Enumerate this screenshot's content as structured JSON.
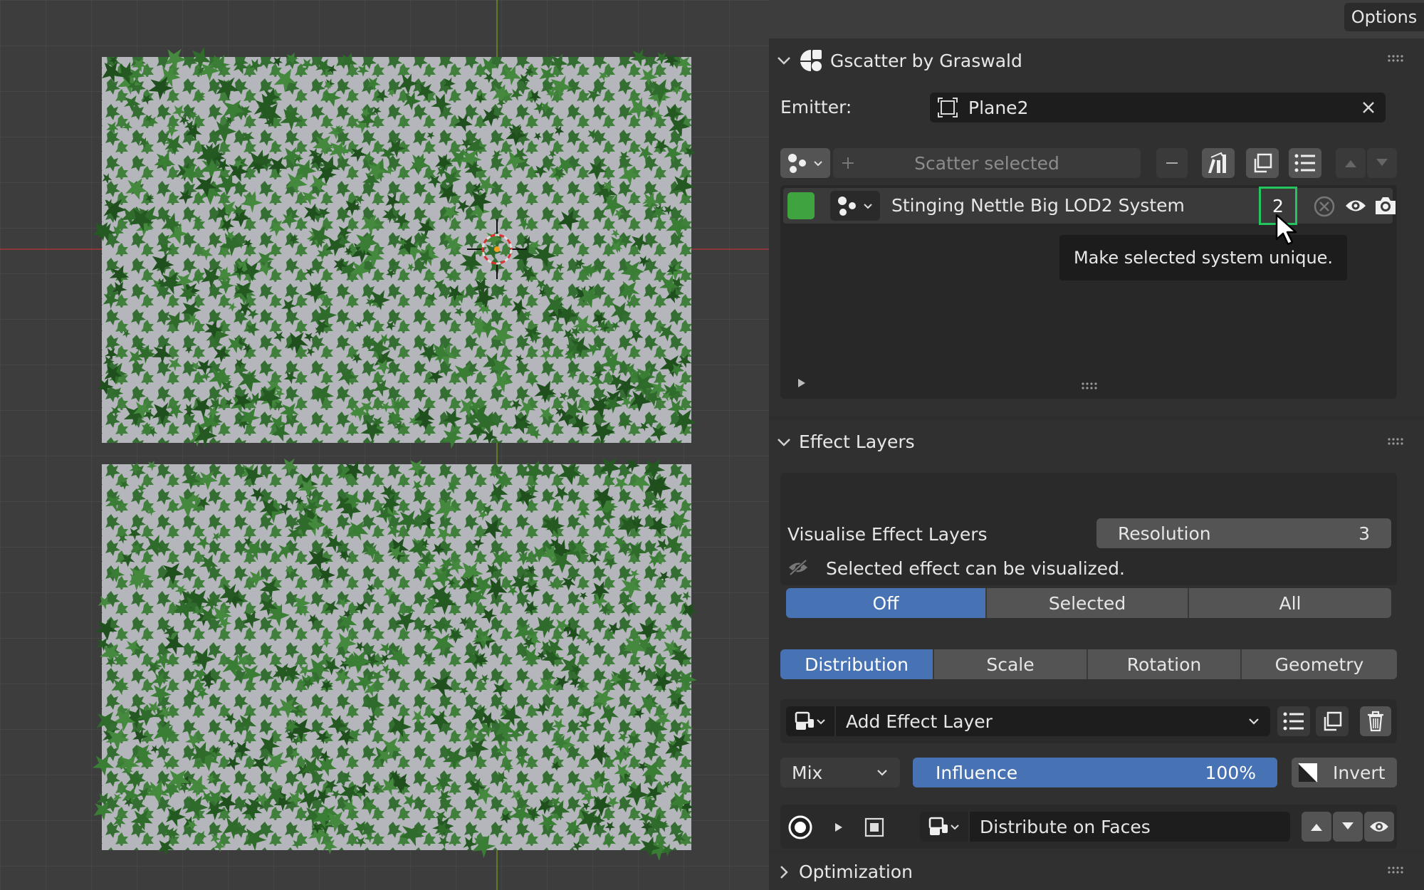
{
  "header": {
    "options_label": "Options"
  },
  "gscatter": {
    "title": "Gscatter by Graswald",
    "emitter_label": "Emitter:",
    "emitter_value": "Plane2",
    "scatter_button": "Scatter selected",
    "system": {
      "name": "Stinging Nettle Big LOD2 System",
      "user_count": "2",
      "color": "#3fa33f"
    },
    "tooltip": "Make selected system unique."
  },
  "effect_layers": {
    "title": "Effect Layers",
    "visualise_label": "Visualise Effect Layers",
    "resolution_label": "Resolution",
    "resolution_value": "3",
    "info_text": "Selected effect can be visualized.",
    "visualise_modes": [
      {
        "label": "Off",
        "active": true
      },
      {
        "label": "Selected",
        "active": false
      },
      {
        "label": "All",
        "active": false
      }
    ],
    "tabs": [
      {
        "label": "Distribution",
        "active": true
      },
      {
        "label": "Scale",
        "active": false
      },
      {
        "label": "Rotation",
        "active": false
      },
      {
        "label": "Geometry",
        "active": false
      }
    ],
    "add_layer_label": "Add Effect Layer",
    "blend_mode": "Mix",
    "influence_label": "Influence",
    "influence_value": "100%",
    "influence_fraction": 1.0,
    "invert_label": "Invert",
    "layer_name": "Distribute on Faces"
  },
  "optimization": {
    "title": "Optimization"
  },
  "colors": {
    "accent_blue": "#4772b3",
    "highlight_green": "#22c55e",
    "foliage_green": "#2f6b2a",
    "plane_gray": "#b4b6bb"
  },
  "icons": [
    "gscatter-logo-icon",
    "chevron-down-icon",
    "chevron-right-icon",
    "object-icon",
    "close-icon",
    "particle-system-icon",
    "plus-icon",
    "minus-icon",
    "bars-icon",
    "copy-icon",
    "list-icon",
    "arrow-up-icon",
    "arrow-down-icon",
    "disable-icon",
    "eye-icon",
    "camera-icon",
    "hidden-eye-icon",
    "effect-layer-icon",
    "trash-icon",
    "invert-icon",
    "radio-icon",
    "play-icon",
    "checkbox-icon",
    "mouse-cursor-icon"
  ]
}
